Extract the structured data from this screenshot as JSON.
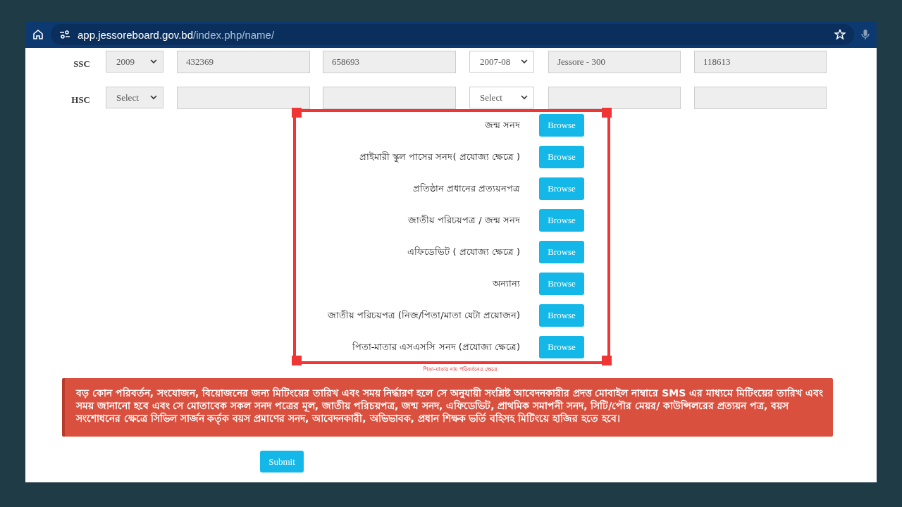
{
  "browser": {
    "url_host": "app.jessoreboard.gov.bd",
    "url_path": "/index.php/name/"
  },
  "exams": [
    {
      "label": "SSC",
      "year": "2009",
      "field_1": "432369",
      "field_2": "658693",
      "session": "2007-08",
      "board": "Jessore - 300",
      "field_5": "118613"
    },
    {
      "label": "HSC",
      "year": "Select",
      "session": "Select"
    }
  ],
  "documents": [
    {
      "label": "জন্ম সনদ",
      "button": "Browse"
    },
    {
      "label": "প্রাইমারী স্কুল পাসের সনদ( প্রযোজ্য ক্ষেত্রে )",
      "button": "Browse"
    },
    {
      "label": "প্রতিষ্ঠান প্রধানের প্রত্যয়নপত্র",
      "button": "Browse"
    },
    {
      "label": "জাতীয় পরিচয়পত্র / জন্ম সনদ",
      "button": "Browse"
    },
    {
      "label": "এফিডেভিট ( প্রযোজ্য ক্ষেত্রে )",
      "button": "Browse"
    },
    {
      "label": "অন্যান্য",
      "button": "Browse"
    },
    {
      "label": "জাতীয় পরিচয়পত্র (নিজ/পিতা/মাতা যেটা প্রয়োজন)",
      "button": "Browse"
    },
    {
      "label": "পিতা-মাতার এসএসসি সনদ (প্রযোজ্য ক্ষেত্রে)",
      "button": "Browse"
    }
  ],
  "documents_note": "পিতা-মাতার নাম পরিবর্তনের ক্ষেত্রে",
  "notice": "বড় কোন পরিবর্তন, সংযোজন, বিয়োজনের জন্য মিটিংয়ের তারিখ এবং সময় নির্দ্ধারণ হলে সে অনুযায়ী সংশ্লিষ্ট আবেদনকারীর প্রদত্ত মোবাইল নাম্বারে SMS এর মাধ্যমে মিটিংয়ের তারিখ এবং সময় জানানো হবে এবং সে মোতাবেক সকল সনদ পত্রের মূল, জাতীয় পরিচয়পত্র, জন্ম সনদ, এফিডেভিট, প্রাথমিক সমাপনী সনদ, সিটি/পৌর মেয়র/ কাউন্সিলরের প্রত্যয়ন পত্র, বয়স সংশোধনের ক্ষেত্রে সিভিল সার্জন কর্তৃক বয়স প্রমাণের সনদ, আবেদনকারী, অভিভাবক, প্রধান শিক্ষক ভর্তি বহিসহ মিটিংয়ে হাজির হতে হবে।",
  "submit": "Submit"
}
